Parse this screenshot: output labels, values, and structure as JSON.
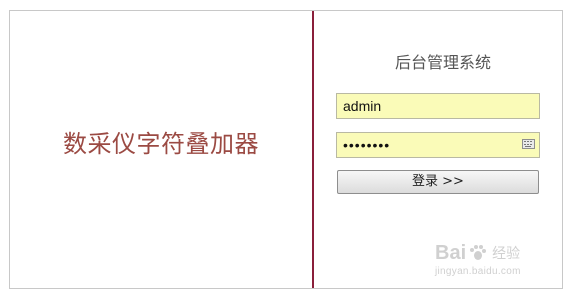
{
  "brand": {
    "title": "数采仪字符叠加器"
  },
  "login": {
    "system_title": "后台管理系统",
    "username_value": "admin",
    "password_value": "••••••••",
    "login_button_label": "登录 >>"
  },
  "watermark": {
    "logo_text_1": "Bai",
    "logo_text_2": "经验",
    "url": "jingyan.baidu.com"
  },
  "colors": {
    "brand_title": "#9b4a43",
    "divider": "#8a1f3a",
    "field_background": "#fafbb8"
  }
}
